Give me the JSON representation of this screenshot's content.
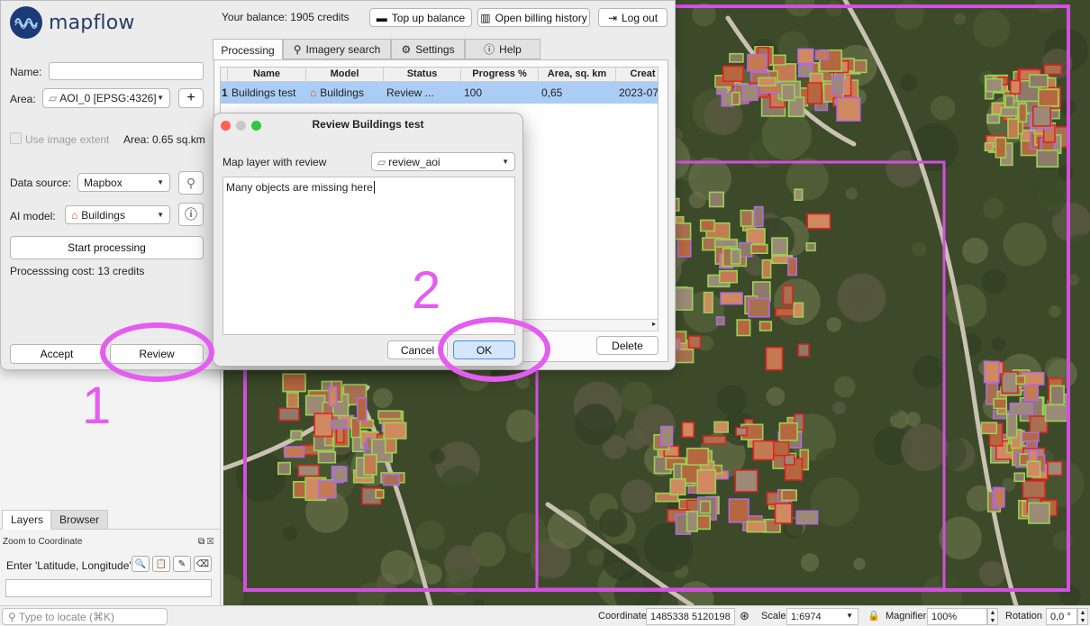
{
  "app": {
    "logo_text": "mapflow",
    "accent_color": "#1d3a78",
    "selection_color": "#abcdf5",
    "annotation_color": "#e45cf0"
  },
  "header": {
    "balance_text": "Your balance: 1905 credits",
    "topup_label": "Top up balance",
    "billing_label": "Open billing history",
    "logout_label": "Log out"
  },
  "form": {
    "name_label": "Name:",
    "name_value": "",
    "area_label": "Area:",
    "area_value": "AOI_0 [EPSG:4326]",
    "add_area_label": "+",
    "use_extent_label": "Use image extent",
    "area_size_text": "Area: 0.65 sq.km",
    "data_source_label": "Data source:",
    "data_source_value": "Mapbox",
    "ai_model_label": "AI model:",
    "ai_model_value": "Buildings",
    "start_label": "Start processing",
    "cost_text": "Processsing cost: 13 credits",
    "accept_label": "Accept",
    "review_label": "Review"
  },
  "tabs": [
    {
      "label": "Processing",
      "active": true
    },
    {
      "label": "Imagery search",
      "active": false
    },
    {
      "label": "Settings",
      "active": false
    },
    {
      "label": "Help",
      "active": false
    }
  ],
  "table": {
    "columns": [
      "Name",
      "Model",
      "Status",
      "Progress %",
      "Area, sq. km",
      "Creat"
    ],
    "rows": [
      {
        "index": "1",
        "name": "Buildings test",
        "model": "Buildings",
        "status": "Review ...",
        "progress": "100",
        "area": "0,65",
        "created": "2023-07"
      }
    ],
    "delete_label": "Delete"
  },
  "dialog": {
    "title": "Review Buildings test",
    "layer_label": "Map layer with review",
    "layer_value": "review_aoi",
    "comment": "Many objects are missing here",
    "cancel_label": "Cancel",
    "ok_label": "OK"
  },
  "annotations": {
    "one": "1",
    "two": "2"
  },
  "panels": {
    "layers_tab": "Layers",
    "browser_tab": "Browser",
    "zoom_title": "Zoom to Coordinate",
    "zoom_label": "Enter 'Latitude, Longitude'"
  },
  "statusbar": {
    "locate_placeholder": "Type to locate (⌘K)",
    "coordinate_label": "Coordinate",
    "coordinate_value": "1485338  5120198",
    "scale_label": "Scale",
    "scale_value": "1:6974",
    "magnifier_label": "Magnifier",
    "magnifier_value": "100%",
    "rotation_label": "Rotation",
    "rotation_value": "0,0 °"
  }
}
